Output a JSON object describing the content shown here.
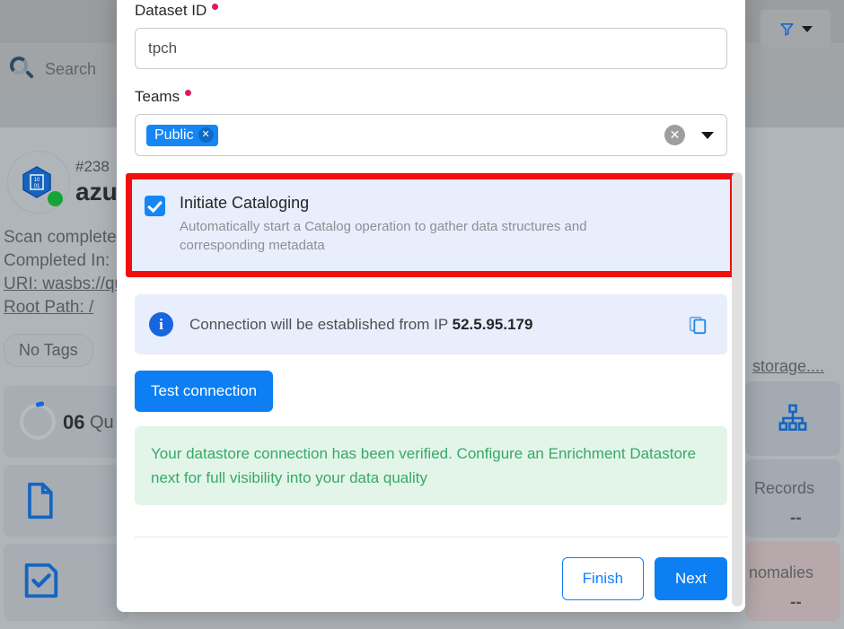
{
  "background": {
    "search": {
      "placeholder": "Search",
      "icon": "search-icon"
    },
    "filter": {
      "icon": "funnel-icon",
      "caret": "chevron-down-icon"
    },
    "datastore": {
      "id_label": "#238",
      "name": "azur",
      "icon": "azure-datastore-icon",
      "status": "online",
      "meta_lines": [
        "Scan complete",
        "Completed In: ",
        "URI: wasbs://qu",
        "Root Path: /"
      ],
      "uri_right_fragment": "storage....",
      "tag": "No Tags"
    },
    "stats": {
      "quality_number": "06",
      "quality_label": "Qu",
      "records_label": "Records",
      "records_value": "--",
      "anomalies_label": "nomalies",
      "anomalies_value": "--",
      "tree_icon": "hierarchy-icon",
      "doc_icon": "document-icon",
      "check_icon": "checklist-icon"
    }
  },
  "modal": {
    "dataset_id": {
      "label": "Dataset ID",
      "required": true,
      "value": "tpch",
      "placeholder": "Dataset ID"
    },
    "teams": {
      "label": "Teams",
      "required": true,
      "chips": [
        {
          "label": "Public",
          "remove_icon": "chip-remove-icon"
        }
      ],
      "clear_icon": "clear-icon",
      "caret_icon": "chevron-down-icon"
    },
    "cataloging": {
      "checked": true,
      "title": "Initiate Cataloging",
      "description": "Automatically start a Catalog operation to gather data structures and corresponding metadata",
      "highlight_color": "#f20f0f"
    },
    "info": {
      "icon": "info-icon",
      "text_prefix": "Connection will be established from IP ",
      "ip": "52.5.95.179",
      "copy_icon": "copy-icon"
    },
    "test_connection_label": "Test connection",
    "success_message": "Your datastore connection has been verified. Configure an Enrichment Datastore next for full visibility into your data quality",
    "footer": {
      "finish_label": "Finish",
      "next_label": "Next"
    }
  },
  "colors": {
    "primary_blue": "#0d7ff2",
    "chip_blue": "#1686f4",
    "success_green": "#38a868",
    "required_red": "#e31b54",
    "annotation_red": "#f20f0f",
    "info_bg": "#e8eefb",
    "success_bg": "#e3f5e9"
  }
}
